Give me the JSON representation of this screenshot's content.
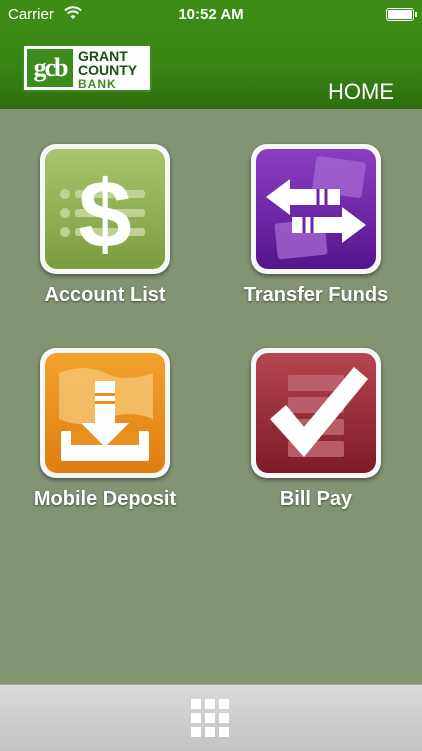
{
  "status_bar": {
    "carrier": "Carrier",
    "time": "10:52 AM"
  },
  "header": {
    "logo": {
      "mark": "gcb",
      "line1": "GRANT",
      "line2": "COUNTY",
      "line3": "BANK"
    },
    "page_title": "HOME"
  },
  "tiles": [
    {
      "label": "Account List",
      "icon": "dollar-list-icon",
      "color": "#8fae4f"
    },
    {
      "label": "Transfer Funds",
      "icon": "transfer-arrows-icon",
      "color": "#6b24a6"
    },
    {
      "label": "Mobile Deposit",
      "icon": "deposit-download-icon",
      "color": "#ea9020"
    },
    {
      "label": "Bill Pay",
      "icon": "checkmark-icon",
      "color": "#9a2f39"
    }
  ],
  "bottom_bar": {
    "icon": "grid-menu-icon"
  },
  "colors": {
    "header": "#3a8614",
    "background": "#839473",
    "bottom_bar": "#cfcfcf"
  }
}
